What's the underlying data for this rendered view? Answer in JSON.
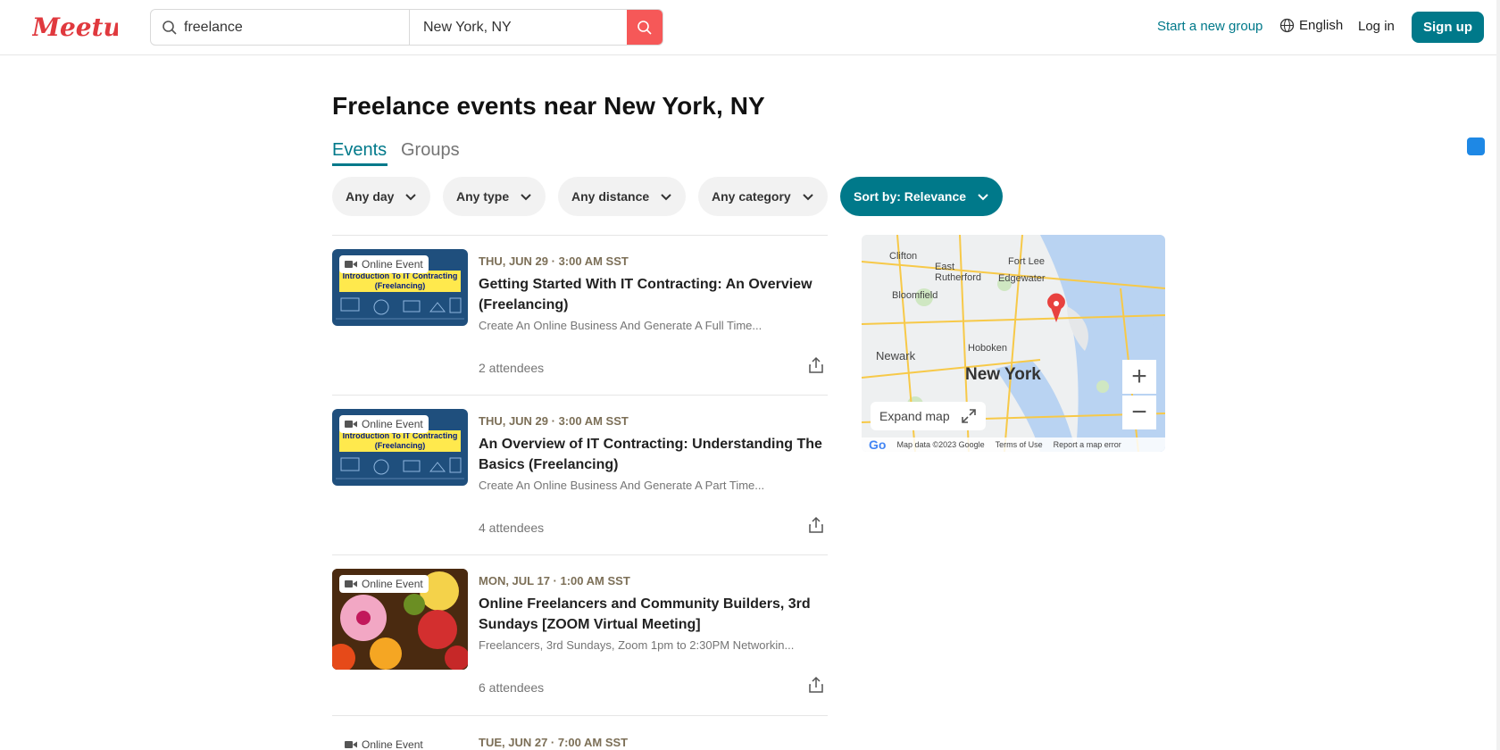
{
  "header": {
    "logo_text": "Meetup",
    "search_keyword": "freelance",
    "search_location": "New York, NY",
    "start_group": "Start a new group",
    "language": "English",
    "login": "Log in",
    "signup": "Sign up"
  },
  "page": {
    "title": "Freelance events near New York, NY",
    "tabs": [
      "Events",
      "Groups"
    ],
    "active_tab": "Events"
  },
  "filters": [
    "Any day",
    "Any type",
    "Any distance",
    "Any category",
    "Sort by: Relevance"
  ],
  "events": [
    {
      "badge": "Online Event",
      "thumb_text": "Introduction To IT Contracting (Freelancing)",
      "date": "THU, JUN 29 · 3:00 AM SST",
      "title": "Getting Started With IT Contracting: An Overview (Freelancing)",
      "description": "Create An Online Business And Generate A Full Time...",
      "attendees": "2 attendees"
    },
    {
      "badge": "Online Event",
      "thumb_text": "Introduction To IT Contracting (Freelancing)",
      "date": "THU, JUN 29 · 3:00 AM SST",
      "title": "An Overview of IT Contracting: Understanding The Basics (Freelancing)",
      "description": "Create An Online Business And Generate A Part Time...",
      "attendees": "4 attendees"
    },
    {
      "badge": "Online Event",
      "date": "MON, JUL 17 · 1:00 AM SST",
      "title": "Online Freelancers and Community Builders, 3rd Sundays [ZOOM Virtual Meeting]",
      "description": "Freelancers, 3rd Sundays, Zoom 1pm to 2:30PM Networkin...",
      "attendees": "6 attendees"
    },
    {
      "badge": "Online Event",
      "date": "TUE, JUN 27 · 7:00 AM SST"
    }
  ],
  "map": {
    "city": "New York",
    "labels": [
      "Clifton",
      "East Rutherford",
      "Fort Lee",
      "Edgewater",
      "Bloomfield",
      "Newark",
      "Hoboken"
    ],
    "expand": "Expand map",
    "attribution": [
      "Map data ©2023 Google",
      "Terms of Use",
      "Report a map error"
    ],
    "zoom_in": "+",
    "zoom_out": "−"
  },
  "colors": {
    "brand": "#00798a",
    "search_button": "#f65858",
    "logo": "#e0393e",
    "date_text": "#7c6f57"
  }
}
